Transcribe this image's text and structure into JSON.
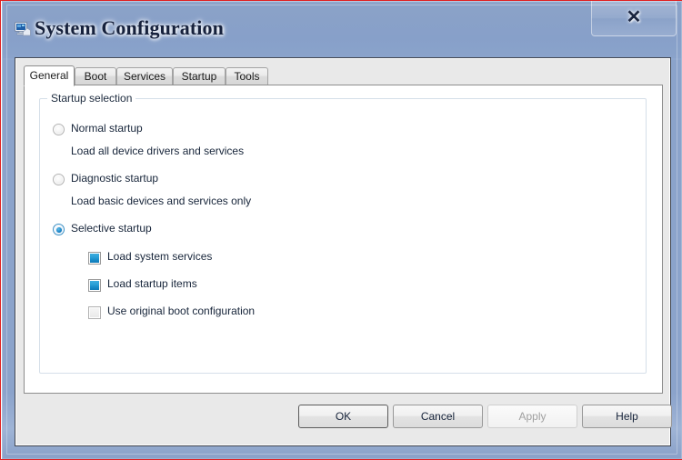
{
  "window": {
    "title": "System Configuration",
    "icon": "computer-monitor-icon",
    "close_label": "✕",
    "frame_color": "#8ba3cb",
    "accent_color": "#1588c6"
  },
  "tabs": [
    {
      "label": "General",
      "active": true
    },
    {
      "label": "Boot",
      "active": false
    },
    {
      "label": "Services",
      "active": false
    },
    {
      "label": "Startup",
      "active": false
    },
    {
      "label": "Tools",
      "active": false
    }
  ],
  "general_tab": {
    "group_label": "Startup selection",
    "options": [
      {
        "label": "Normal startup",
        "description": "Load all device drivers and services",
        "selected": false
      },
      {
        "label": "Diagnostic startup",
        "description": "Load basic devices and services only",
        "selected": false
      },
      {
        "label": "Selective startup",
        "description": "",
        "selected": true
      }
    ],
    "checkboxes": [
      {
        "label": "Load system services",
        "checked": true
      },
      {
        "label": "Load startup items",
        "checked": true
      },
      {
        "label": "Use original boot configuration",
        "checked": false
      }
    ]
  },
  "footer": {
    "buttons": [
      {
        "label": "OK",
        "enabled": true,
        "default": true
      },
      {
        "label": "Cancel",
        "enabled": true,
        "default": false
      },
      {
        "label": "Apply",
        "enabled": false,
        "default": false
      },
      {
        "label": "Help",
        "enabled": true,
        "default": false
      }
    ]
  }
}
